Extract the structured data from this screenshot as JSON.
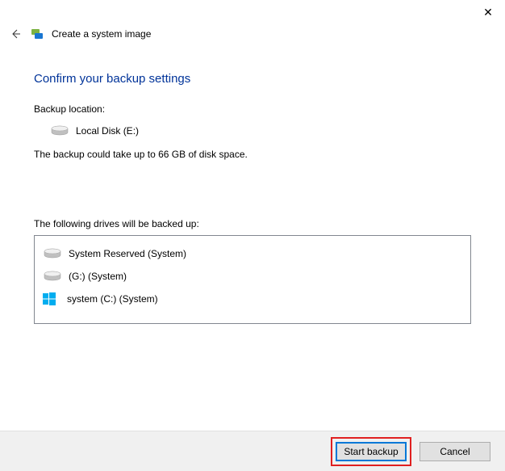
{
  "titlebar": {
    "close_symbol": "✕"
  },
  "header": {
    "app_title": "Create a system image"
  },
  "content": {
    "main_heading": "Confirm your backup settings",
    "backup_location_label": "Backup location:",
    "backup_location_name": "Local Disk (E:)",
    "size_note": "The backup could take up to 66 GB of disk space.",
    "drives_label": "The following drives will be backed up:",
    "drives": [
      {
        "name": "System Reserved (System)",
        "icon": "disk"
      },
      {
        "name": "(G:) (System)",
        "icon": "disk"
      },
      {
        "name": "system (C:) (System)",
        "icon": "windows"
      }
    ]
  },
  "footer": {
    "start_label": "Start backup",
    "cancel_label": "Cancel"
  }
}
